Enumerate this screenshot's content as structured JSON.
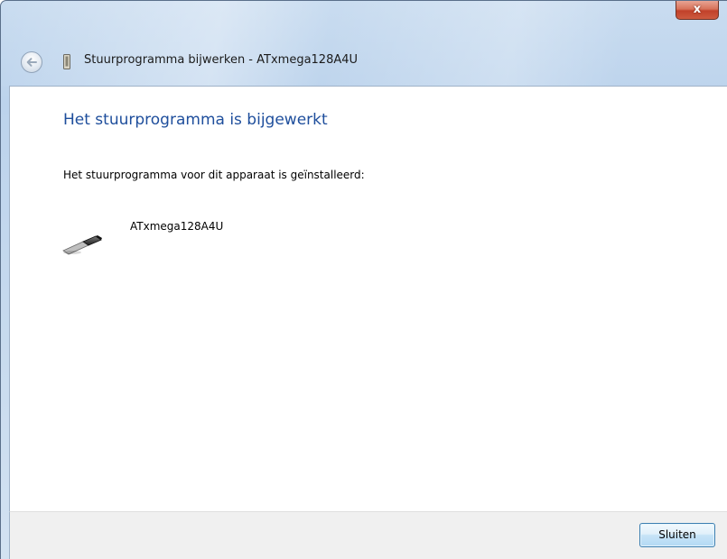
{
  "window": {
    "title": "Stuurprogramma bijwerken - ATxmega128A4U",
    "close_glyph": "x"
  },
  "main": {
    "heading": "Het stuurprogramma is bijgewerkt",
    "description": "Het stuurprogramma voor dit apparaat is geïnstalleerd:",
    "device_name": "ATxmega128A4U"
  },
  "footer": {
    "close_label": "Sluiten"
  },
  "icons": {
    "back": "back-arrow-icon",
    "title_device": "device-icon",
    "device": "usb-device-icon"
  },
  "colors": {
    "heading": "#1e4e9c",
    "close_window": "#c1412a",
    "button_border": "#3c7fb1"
  }
}
